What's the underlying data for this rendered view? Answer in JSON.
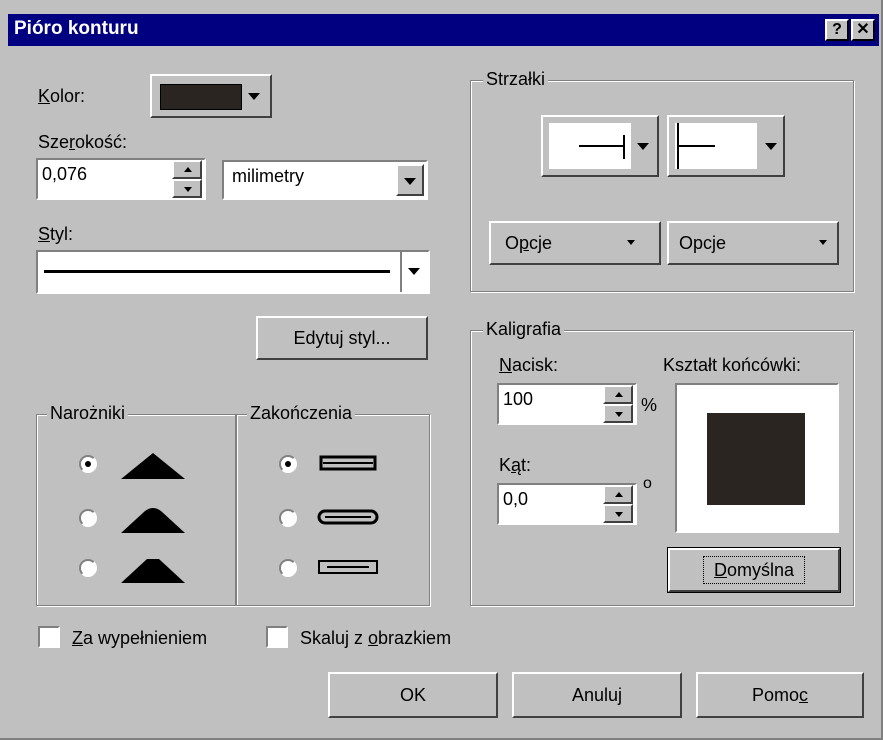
{
  "window": {
    "title": "Pióro konturu",
    "help_glyph": "?",
    "close_glyph": "✕"
  },
  "color": {
    "label_first": "K",
    "label_rest": "olor:",
    "swatch": "#2b2521"
  },
  "width": {
    "label_pre": "Sze",
    "label_acc": "r",
    "label_post": "okość:",
    "value": "0,076",
    "unit": "milimetry"
  },
  "style": {
    "label_first": "S",
    "label_rest": "tyl:",
    "edit_button": "Edytuj styl..."
  },
  "corners": {
    "title": "Narożniki",
    "selected": 0
  },
  "caps": {
    "title": "Zakończenia",
    "selected": 0
  },
  "arrows": {
    "title": "Strzałki",
    "options_left": {
      "pre": "O",
      "acc": "p",
      "post": "cje"
    },
    "options_right": {
      "pre": "Opc",
      "acc": "j",
      "post": "e"
    }
  },
  "calligraphy": {
    "title": "Kaligrafia",
    "pressure_label_first": "N",
    "pressure_label_rest": "acisk:",
    "pressure_value": "100",
    "pressure_unit": "%",
    "angle_label_pre": "K",
    "angle_label_acc": "ą",
    "angle_label_post": "t:",
    "angle_value": "0,0",
    "angle_unit": "o",
    "nib_label": "Kształt końcówki:",
    "nib_color": "#2b2521",
    "default_button": {
      "pre": "",
      "acc": "D",
      "post": "omyślna"
    }
  },
  "checkboxes": {
    "behind_fill": {
      "acc": "Z",
      "rest": "a wypełnieniem",
      "checked": false
    },
    "scale_with_image": {
      "pre": "Skaluj z ",
      "acc": "o",
      "post": "brazkiem",
      "checked": false
    }
  },
  "buttons": {
    "ok": "OK",
    "cancel": "Anuluj",
    "help_pre": "Pomo",
    "help_acc": "c"
  }
}
